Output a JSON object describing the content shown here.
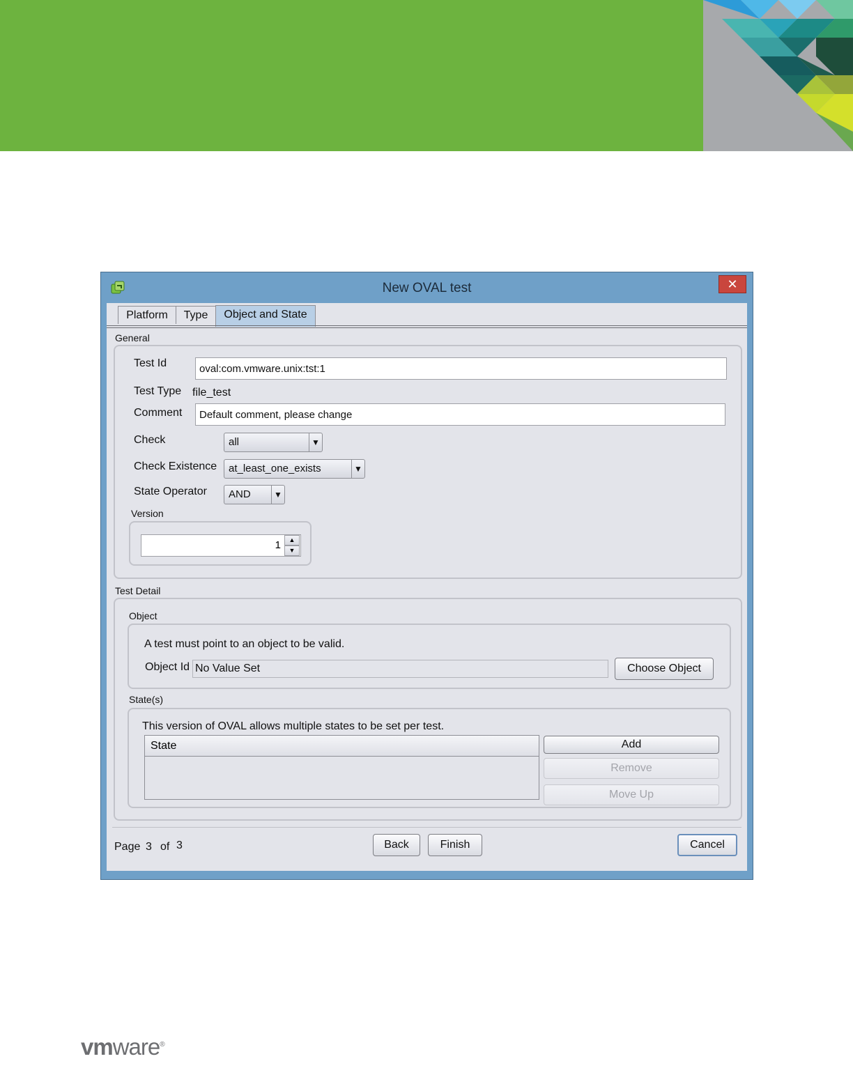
{
  "dialog": {
    "title": "New OVAL test",
    "close_label": "✕",
    "tabs": [
      {
        "label": "Platform"
      },
      {
        "label": "Type"
      },
      {
        "label": "Object and State"
      }
    ]
  },
  "general": {
    "section_label": "General",
    "test_id_label": "Test Id",
    "test_id_value": "oval:com.vmware.unix:tst:1",
    "test_type_label": "Test Type",
    "test_type_value": "file_test",
    "comment_label": "Comment",
    "comment_value": "Default comment, please change",
    "check_label": "Check",
    "check_value": "all",
    "check_existence_label": "Check Existence",
    "check_existence_value": "at_least_one_exists",
    "state_operator_label": "State Operator",
    "state_operator_value": "AND",
    "version_label": "Version",
    "version_value": "1"
  },
  "test_detail": {
    "section_label": "Test Detail",
    "object": {
      "group_label": "Object",
      "message": "A test must point to an object to be valid.",
      "object_id_label": "Object Id",
      "object_id_value": "No Value Set",
      "choose_button": "Choose Object"
    },
    "states": {
      "group_label": "State(s)",
      "message": "This version of OVAL allows multiple states to be set per test.",
      "table_header": "State",
      "add_button": "Add",
      "remove_button": "Remove",
      "move_up_button": "Move Up"
    }
  },
  "footer": {
    "page_label": "Page",
    "page_current": "3",
    "of_label": "of",
    "page_total": "3",
    "back_button": "Back",
    "finish_button": "Finish",
    "cancel_button": "Cancel"
  },
  "brand": {
    "logo_bold": "vm",
    "logo_rest": "ware",
    "logo_mark": "®",
    "banner_color": "#6db33f"
  },
  "icons": [
    "app-icon",
    "close-icon",
    "chevron-down-icon",
    "spin-up-icon",
    "spin-down-icon"
  ]
}
